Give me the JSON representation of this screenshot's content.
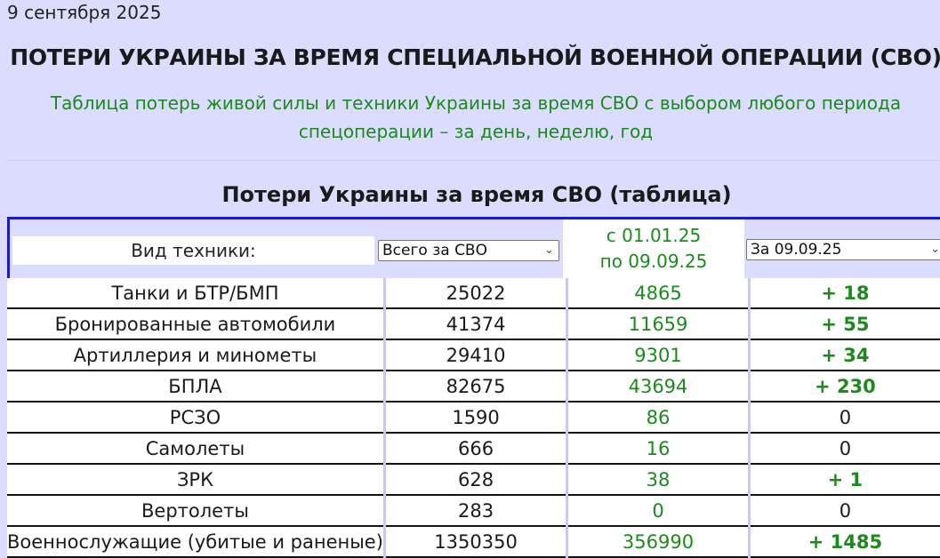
{
  "date": "9 сентября 2025",
  "main_title": "ПОТЕРИ УКРАИНЫ ЗА ВРЕМЯ СПЕЦИАЛЬНОЙ ВОЕННОЙ ОПЕРАЦИИ (СВО)",
  "subtitle": "Таблица потерь живой силы и техники Украины за время СВО с выбором любого периода спецоперации – за день, неделю, год",
  "table_title": "Потери Украины за время СВО (таблица)",
  "header": {
    "type_label": "Вид техники:",
    "total_select": "Всего за СВО",
    "period_from": "с 01.01.25",
    "period_to": "по 09.09.25",
    "day_select": "За 09.09.25"
  },
  "rows": [
    {
      "name": "Танки и БТР/БМП",
      "total": "25022",
      "period": "4865",
      "day": "+ 18"
    },
    {
      "name": "Бронированные автомобили",
      "total": "41374",
      "period": "11659",
      "day": "+ 55"
    },
    {
      "name": "Артиллерия и минометы",
      "total": "29410",
      "period": "9301",
      "day": "+ 34"
    },
    {
      "name": "БПЛА",
      "total": "82675",
      "period": "43694",
      "day": "+ 230"
    },
    {
      "name": "РСЗО",
      "total": "1590",
      "period": "86",
      "day": "0"
    },
    {
      "name": "Самолеты",
      "total": "666",
      "period": "16",
      "day": "0"
    },
    {
      "name": "ЗРК",
      "total": "628",
      "period": "38",
      "day": "+ 1"
    },
    {
      "name": "Вертолеты",
      "total": "283",
      "period": "0",
      "day": "0"
    },
    {
      "name": "Военнослужащие (убитые и раненые)",
      "total": "1350350",
      "period": "356990",
      "day": "+ 1485"
    }
  ],
  "colors": {
    "background": "#dcdcff",
    "accent_green": "#1c8a1c",
    "header_border": "#1a1ad0"
  },
  "icons": {
    "select_chevron": "chevron-down-icon"
  }
}
